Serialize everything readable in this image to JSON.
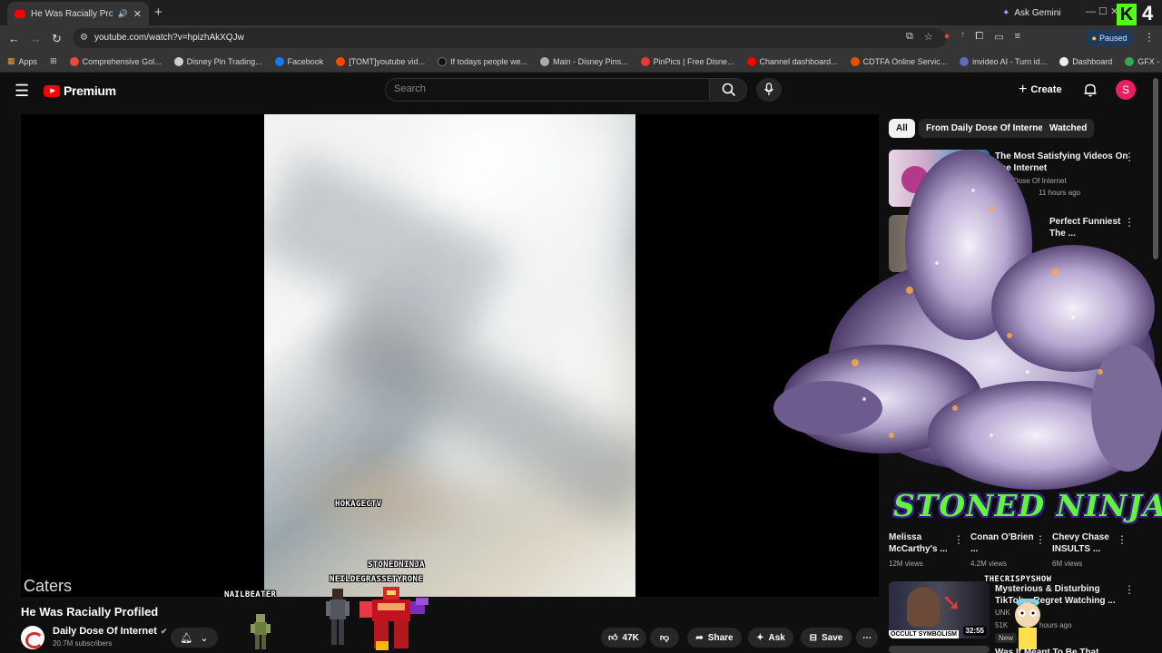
{
  "browser": {
    "tab_title": "He Was Racially Profiled - Y",
    "new_tab": "+",
    "ask_gemini": "Ask Gemini",
    "window_controls": "—   ☐   ✕",
    "k_badge": "K",
    "k_number": "4",
    "url": "youtube.com/watch?v=hpizhAkXQJw",
    "paused_label": "Paused",
    "bookmarks": [
      {
        "label": "Apps",
        "color": "#888888"
      },
      {
        "label": "Comprehensive Gol...",
        "color": "#e74c3c"
      },
      {
        "label": "Disney Pin Trading...",
        "color": "#cccccc"
      },
      {
        "label": "Facebook",
        "color": "#1877f2"
      },
      {
        "label": "[TOMT]youtube vid...",
        "color": "#ff4500"
      },
      {
        "label": "If todays people we...",
        "color": "#111111"
      },
      {
        "label": "Main - Disney Pins...",
        "color": "#aaaaaa"
      },
      {
        "label": "PinPics | Free Disne...",
        "color": "#e53935"
      },
      {
        "label": "Channel dashboard...",
        "color": "#ff0000"
      },
      {
        "label": "CDTFA Online Servic...",
        "color": "#e65100"
      },
      {
        "label": "invideo AI - Turn id...",
        "color": "#5c6bc0"
      },
      {
        "label": "Dashboard",
        "color": "#eeeeee"
      },
      {
        "label": "GFX - Google Drive",
        "color": "#34a853"
      }
    ]
  },
  "yt": {
    "logo_text": "Premium",
    "search_placeholder": "Search",
    "create_label": "Create",
    "avatar_letter": "S"
  },
  "player": {
    "caters": "Caters",
    "overlay_names": {
      "hokage": "HOKAGECTV",
      "stoned": "STONEDNINJA",
      "neil": "NEILDEGRASSETYRONE",
      "nail": "NAILBEATER",
      "crispy": "THECRISPYSHOW"
    }
  },
  "video": {
    "title": "He Was Racially Profiled",
    "channel": "Daily Dose Of Internet",
    "subscribers": "20.7M subscribers",
    "likes": "47K",
    "share": "Share",
    "ask": "Ask",
    "save": "Save"
  },
  "sidebar": {
    "chips": [
      "All",
      "From Daily Dose Of Internet",
      "Watched"
    ],
    "rec1": {
      "title_line1": "The Most Satisfying Videos On",
      "title_line2": "The Internet",
      "channel": "Daily Dose Of Internet",
      "meta": "11 hours ago"
    },
    "rec2": {
      "title_line1": "Perfect Funniest",
      "title_line2": "The ...",
      "meta": "ago"
    },
    "shorts": [
      {
        "title": "Melissa McCarthy's ...",
        "views": "12M views"
      },
      {
        "title": "Conan O'Brien ...",
        "views": "4.2M views"
      },
      {
        "title": "Chevy Chase INSULTS ...",
        "views": "6M views"
      }
    ],
    "rec3": {
      "title_line1": "Mysterious & Disturbing",
      "title_line2": "TikTok... Regret Watching ...",
      "channel": "UNK",
      "views": "51K",
      "meta": "hours ago",
      "badge_new": "New",
      "duration": "32:55",
      "thumb_caption": "OCCULT SYMBOLISM"
    },
    "rec4": {
      "title": "Was It Meant To Be That"
    }
  },
  "overlay": {
    "stoned_ninja": "STONED NINJA"
  }
}
